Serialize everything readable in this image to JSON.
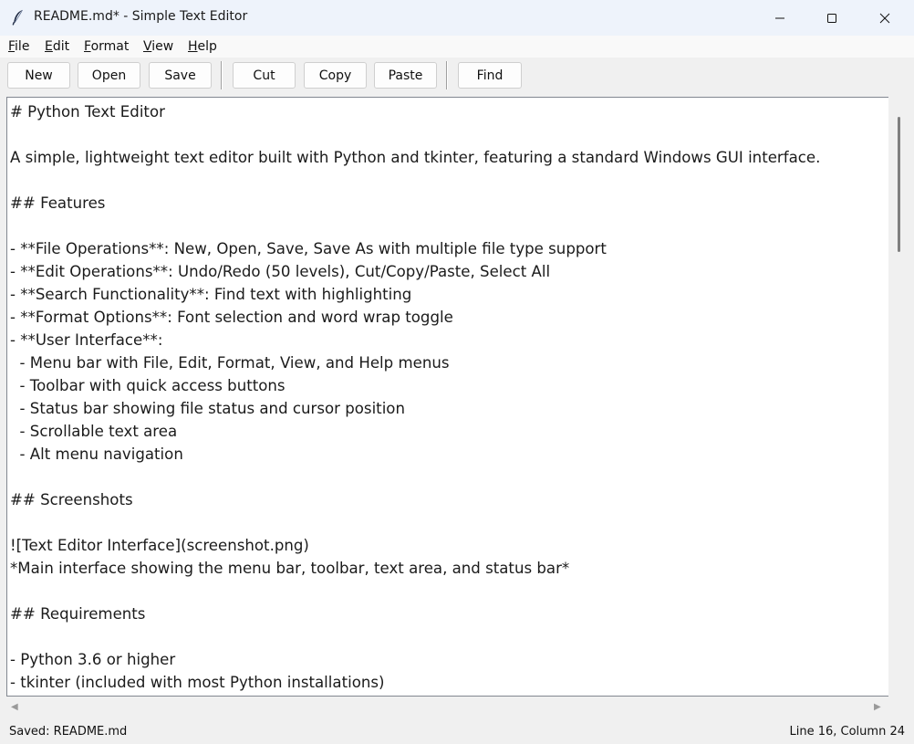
{
  "window": {
    "title": "README.md* - Simple Text Editor",
    "icon": "feather-quill-icon"
  },
  "menu": {
    "file": {
      "mnemonic": "F",
      "rest": "ile"
    },
    "edit": {
      "mnemonic": "E",
      "rest": "dit"
    },
    "format": {
      "mnemonic": "F",
      "rest": "ormat"
    },
    "view": {
      "mnemonic": "V",
      "rest": "iew"
    },
    "help": {
      "mnemonic": "H",
      "rest": "elp"
    }
  },
  "toolbar": {
    "new": "New",
    "open": "Open",
    "save": "Save",
    "cut": "Cut",
    "copy": "Copy",
    "paste": "Paste",
    "find": "Find"
  },
  "editor": {
    "lines": [
      "# Python Text Editor",
      "",
      "A simple, lightweight text editor built with Python and tkinter, featuring a standard Windows GUI interface.",
      "",
      "## Features",
      "",
      "- **File Operations**: New, Open, Save, Save As with multiple file type support",
      "- **Edit Operations**: Undo/Redo (50 levels), Cut/Copy/Paste, Select All",
      "- **Search Functionality**: Find text with highlighting",
      "- **Format Options**: Font selection and word wrap toggle",
      "- **User Interface**:",
      "  - Menu bar with File, Edit, Format, View, and Help menus",
      "  - Toolbar with quick access buttons",
      "  - Status bar showing file status and cursor position",
      "  - Scrollable text area",
      "  - Alt menu navigation",
      "",
      "## Screenshots",
      "",
      "![Text Editor Interface](screenshot.png)",
      "*Main interface showing the menu bar, toolbar, text area, and status bar*",
      "",
      "## Requirements",
      "",
      "- Python 3.6 or higher",
      "- tkinter (included with most Python installations)"
    ]
  },
  "status": {
    "left": "Saved: README.md",
    "right": "Line 16, Column 24"
  },
  "colors": {
    "titlebar": "#eef3fb",
    "editor_bg": "#ffffff",
    "chrome_bg": "#f0f0f0"
  }
}
